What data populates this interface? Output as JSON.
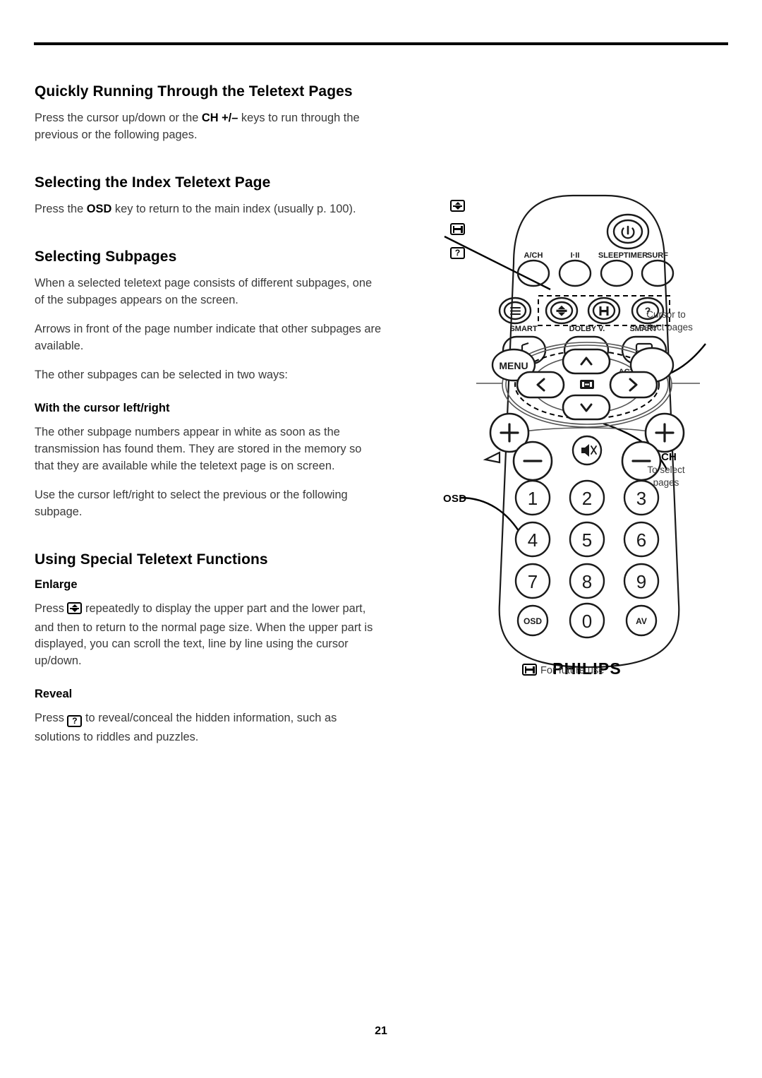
{
  "page": {
    "number": "21"
  },
  "sections": [
    {
      "heading": "Quickly Running Through the Teletext Pages",
      "p1_a": "Press the cursor up/down or the ",
      "p1_kb": "CH +/–",
      "p1_b": " keys to run through the previous or the following pages."
    },
    {
      "heading": "Selecting the Index Teletext Page",
      "p1_a": "Press the ",
      "p1_kb": "OSD",
      "p1_b": " key to return to the main index (usually p. 100)."
    },
    {
      "heading": "Selecting Subpages",
      "p1": "When a selected teletext page consists of different subpages, one of the subpages appears on the screen.",
      "p2": "Arrows in front of the page number indicate that other subpages are available.",
      "p3": "The other subpages can be selected in two ways:",
      "sub1": {
        "heading": "With the cursor left/right",
        "p1": "The other subpage numbers appear in white as soon as the transmission has found them. They are stored in the memory so that they are available while the teletext page is on screen.",
        "p2": "Use the cursor left/right to select the previous or the following subpage."
      }
    },
    {
      "heading": "Using Special Teletext Functions",
      "sub1": {
        "heading": "Enlarge",
        "p1_a": "Press ",
        "p1_icon": "enlarge-icon",
        "p1_b": " repeatedly to display the upper part and the lower part, and then to return to the normal page size. When the upper part is displayed, you can scroll the text, line by line using the cursor up/down."
      },
      "sub2": {
        "heading": "Reveal",
        "p1_a": "Press ",
        "p1_icon": "reveal-icon",
        "p1_b": " to reveal/conceal the hidden information, such as solutions to riddles and puzzles."
      }
    }
  ],
  "margin_icons": [
    {
      "name": "enlarge-icon",
      "glyph": "enlarge"
    },
    {
      "name": "subpage-icon",
      "glyph": "subpage"
    },
    {
      "name": "reveal-icon",
      "glyph": "reveal"
    }
  ],
  "remote": {
    "brand": "PHILIPS",
    "power_label": "",
    "row_labels_1": [
      "A/CH",
      "I·II",
      "SLEEPTIMER",
      "SURF"
    ],
    "row_labels_2": [
      "SMART",
      "DOLBY V.",
      "SMART"
    ],
    "active_ctrl_label": "ACTIVE CTRL",
    "menu_label": "MENU",
    "ch_label": "CH",
    "keypad": [
      [
        "1",
        "2",
        "3"
      ],
      [
        "4",
        "5",
        "6"
      ],
      [
        "7",
        "8",
        "9"
      ],
      [
        "OSD",
        "0",
        "AV"
      ]
    ],
    "teletext_buttons": [
      "text-icon",
      "enlarge-icon",
      "subpage-icon",
      "reveal-icon"
    ]
  },
  "callouts": {
    "cursor_to_select_pages": "Cursor to\nselect pages",
    "cursor_line1": "Cursor to",
    "cursor_line2": "select pages",
    "to_select_line1": "To select",
    "to_select_line2": "pages",
    "osd": "OSD",
    "future_use": "For future use"
  },
  "colors": {
    "text": "#3a3a3a",
    "heading": "#000000",
    "rule": "#000000",
    "outline": "#1a1a1a"
  }
}
